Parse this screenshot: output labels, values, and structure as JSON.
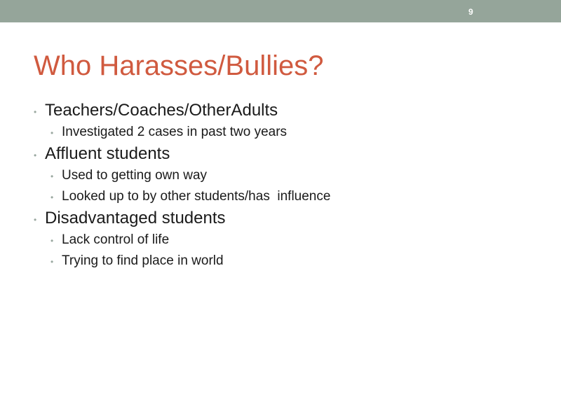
{
  "slide": {
    "number": "9",
    "title": "Who Harasses/Bullies?",
    "bullet_char": "•",
    "bullets": [
      {
        "text": "Teachers/Coaches/OtherAdults",
        "sub": [
          "Investigated 2 cases in past two years"
        ]
      },
      {
        "text": "Affluent students",
        "sub": [
          "Used to getting own way",
          "Looked up to by other students/has  influence"
        ]
      },
      {
        "text": "Disadvantaged students",
        "sub": [
          "Lack control of life",
          "Trying to find place in world"
        ]
      }
    ]
  },
  "colors": {
    "top_bar": "#95a59a",
    "title": "#d05a3f",
    "body_text": "#1a1a1a",
    "bullet_dot": "#9aa8a0"
  }
}
